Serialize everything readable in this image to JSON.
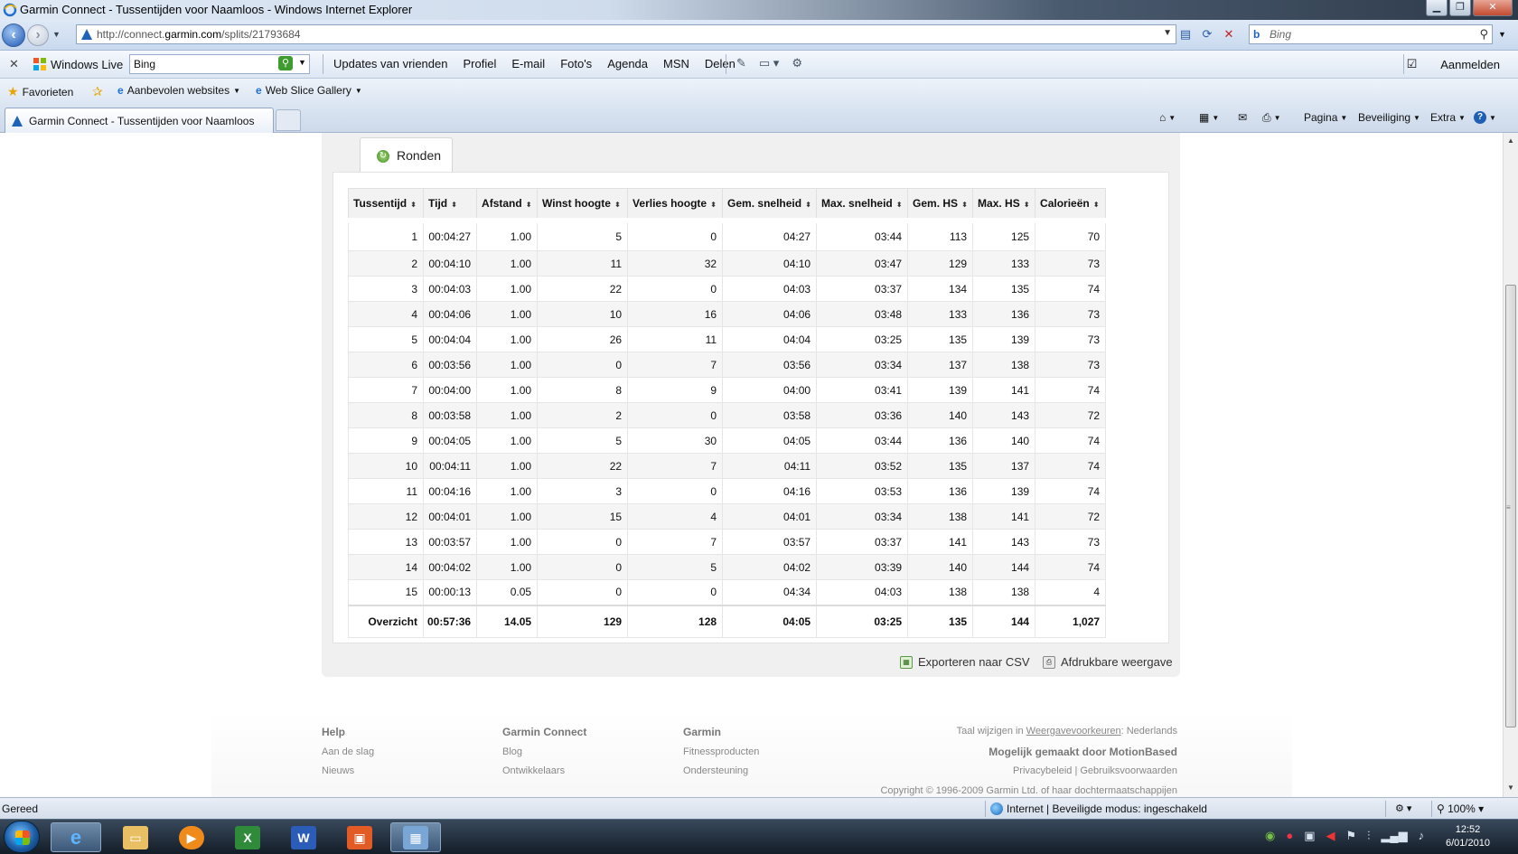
{
  "window": {
    "title": "Garmin Connect - Tussentijden voor Naamloos - Windows Internet Explorer",
    "min_glyph": "▁",
    "max_glyph": "❐",
    "close_glyph": "✕"
  },
  "address": {
    "url_prefix": "http://connect.",
    "url_domain": "garmin.com",
    "url_path": "/splits/21793684",
    "search_placeholder": "Bing"
  },
  "wl_toolbar": {
    "close_glyph": "✕",
    "brand": "Windows Live",
    "search_value": "Bing",
    "links": [
      "Updates van vrienden",
      "Profiel",
      "E-mail",
      "Foto's",
      "Agenda",
      "MSN",
      "Delen"
    ],
    "sign_in": "Aanmelden"
  },
  "favorites": {
    "favorites_label": "Favorieten",
    "suggested_label": "Aanbevolen websites",
    "gallery_label": "Web Slice Gallery"
  },
  "tabs": {
    "active_tab": "Garmin Connect - Tussentijden voor Naamloos",
    "commands": [
      "Pagina",
      "Beveiliging",
      "Extra"
    ]
  },
  "panel": {
    "tab_label": "Ronden"
  },
  "splits_table": {
    "headers": [
      "Tussentijd",
      "Tijd",
      "Afstand",
      "Winst hoogte",
      "Verlies hoogte",
      "Gem. snelheid",
      "Max. snelheid",
      "Gem. HS",
      "Max. HS",
      "Calorieën"
    ],
    "rows": [
      [
        "1",
        "00:04:27",
        "1.00",
        "5",
        "0",
        "04:27",
        "03:44",
        "113",
        "125",
        "70"
      ],
      [
        "2",
        "00:04:10",
        "1.00",
        "11",
        "32",
        "04:10",
        "03:47",
        "129",
        "133",
        "73"
      ],
      [
        "3",
        "00:04:03",
        "1.00",
        "22",
        "0",
        "04:03",
        "03:37",
        "134",
        "135",
        "74"
      ],
      [
        "4",
        "00:04:06",
        "1.00",
        "10",
        "16",
        "04:06",
        "03:48",
        "133",
        "136",
        "73"
      ],
      [
        "5",
        "00:04:04",
        "1.00",
        "26",
        "11",
        "04:04",
        "03:25",
        "135",
        "139",
        "73"
      ],
      [
        "6",
        "00:03:56",
        "1.00",
        "0",
        "7",
        "03:56",
        "03:34",
        "137",
        "138",
        "73"
      ],
      [
        "7",
        "00:04:00",
        "1.00",
        "8",
        "9",
        "04:00",
        "03:41",
        "139",
        "141",
        "74"
      ],
      [
        "8",
        "00:03:58",
        "1.00",
        "2",
        "0",
        "03:58",
        "03:36",
        "140",
        "143",
        "72"
      ],
      [
        "9",
        "00:04:05",
        "1.00",
        "5",
        "30",
        "04:05",
        "03:44",
        "136",
        "140",
        "74"
      ],
      [
        "10",
        "00:04:11",
        "1.00",
        "22",
        "7",
        "04:11",
        "03:52",
        "135",
        "137",
        "74"
      ],
      [
        "11",
        "00:04:16",
        "1.00",
        "3",
        "0",
        "04:16",
        "03:53",
        "136",
        "139",
        "74"
      ],
      [
        "12",
        "00:04:01",
        "1.00",
        "15",
        "4",
        "04:01",
        "03:34",
        "138",
        "141",
        "72"
      ],
      [
        "13",
        "00:03:57",
        "1.00",
        "0",
        "7",
        "03:57",
        "03:37",
        "141",
        "143",
        "73"
      ],
      [
        "14",
        "00:04:02",
        "1.00",
        "0",
        "5",
        "04:02",
        "03:39",
        "140",
        "144",
        "74"
      ],
      [
        "15",
        "00:00:13",
        "0.05",
        "0",
        "0",
        "04:34",
        "04:03",
        "138",
        "138",
        "4"
      ]
    ],
    "summary": [
      "Overzicht",
      "00:57:36",
      "14.05",
      "129",
      "128",
      "04:05",
      "03:25",
      "135",
      "144",
      "1,027"
    ]
  },
  "actions": {
    "export_csv": "Exporteren naar CSV",
    "printable": "Afdrukbare weergave"
  },
  "footer": {
    "help": {
      "heading": "Help",
      "links": [
        "Aan de slag",
        "Nieuws"
      ]
    },
    "garmin_connect": {
      "heading": "Garmin Connect",
      "links": [
        "Blog",
        "Ontwikkelaars"
      ]
    },
    "garmin": {
      "heading": "Garmin",
      "links": [
        "Fitnessproducten",
        "Ondersteuning"
      ]
    },
    "lang_prefix": "Taal wijzigen in",
    "lang_link": "Weergavevoorkeuren",
    "lang_value": ": Nederlands",
    "powered_by": "Mogelijk gemaakt door MotionBased",
    "privacy": "Privacybeleid",
    "terms": "Gebruiksvoorwaarden",
    "copyright": "Copyright © 1996-2009 Garmin Ltd. of haar dochtermaatschappijen"
  },
  "statusbar": {
    "status": "Gereed",
    "zone": "Internet | Beveiligde modus: ingeschakeld",
    "zoom": "100%"
  },
  "taskbar": {
    "time": "12:52",
    "date": "6/01/2010"
  }
}
